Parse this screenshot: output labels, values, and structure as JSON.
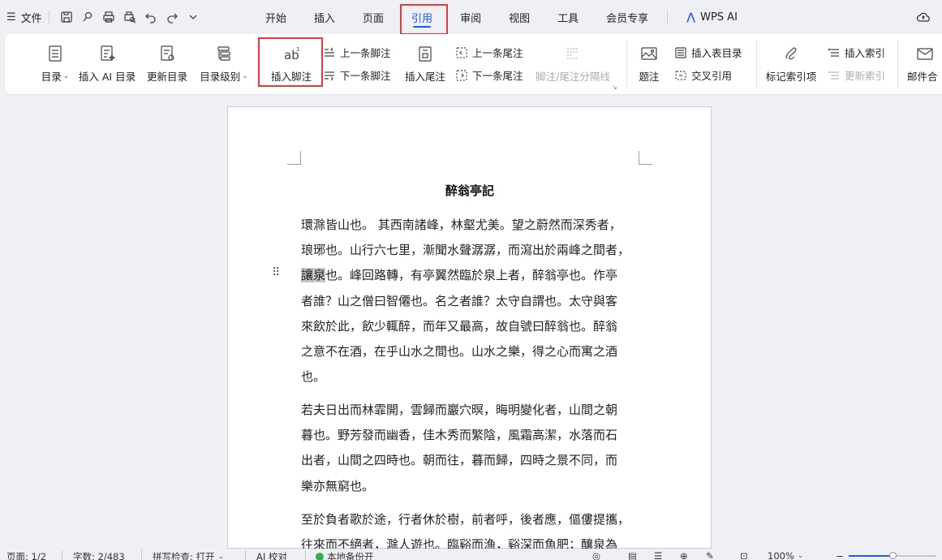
{
  "topbar": {
    "menu_icon": "hamburger-icon",
    "file_label": "文件",
    "quick_access": [
      "save-icon",
      "brush-icon",
      "print-icon",
      "print-preview-icon",
      "undo-icon",
      "redo-icon",
      "more-down-icon"
    ],
    "tabs": [
      {
        "label": "开始",
        "active": false
      },
      {
        "label": "插入",
        "active": false
      },
      {
        "label": "页面",
        "active": false
      },
      {
        "label": "引用",
        "active": true
      },
      {
        "label": "审阅",
        "active": false
      },
      {
        "label": "视图",
        "active": false
      },
      {
        "label": "工具",
        "active": false
      },
      {
        "label": "会员专享",
        "active": false
      }
    ],
    "wps_ai_label": "WPS AI",
    "accent_color": "#1a5cf0",
    "highlight_color": "#e8383d"
  },
  "ribbon": {
    "toc": "目录",
    "insert_ai_toc": "插入 AI 目录",
    "update_toc": "更新目录",
    "toc_level": "目录级别",
    "insert_footnote": "插入脚注",
    "prev_footnote": "上一条脚注",
    "next_footnote": "下一条脚注",
    "insert_endnote": "插入尾注",
    "prev_endnote": "上一条尾注",
    "next_endnote": "下一条尾注",
    "separator_line": "脚注/尾注分隔线",
    "caption": "题注",
    "insert_table_of_figures": "插入表目录",
    "cross_reference": "交叉引用",
    "mark_index_entry": "标记索引项",
    "insert_index": "插入索引",
    "update_index": "更新索引",
    "mail_merge": "邮件合"
  },
  "document": {
    "title": "醉翁亭記",
    "para1_lines": [
      "環滁皆山也。 其西南諸峰，林壑尤美。望之蔚然而深秀者，",
      "琅琊也。山行六七里，漸聞水聲潺潺，而瀉出於兩峰之間者，",
      "也。峰回路轉，有亭翼然臨於泉上者，醉翁亭也。作亭",
      "者誰？山之僧曰智僊也。名之者誰？太守自謂也。太守與客",
      "來飲於此，飲少輒醉，而年又最高，故自號曰醉翁也。醉翁",
      "之意不在酒，在乎山水之間也。山水之樂，得之心而寓之酒",
      "也。"
    ],
    "para1_highlight": "讓泉",
    "para2_lines": [
      "若夫日出而林霏開，雲歸而巖穴暝，晦明變化者，山間之朝",
      "暮也。野芳發而幽香，佳木秀而繁陰，風霜高潔，水落而石",
      "出者，山間之四時也。朝而往，暮而歸，四時之景不同，而",
      "樂亦無窮也。"
    ],
    "para3_lines": [
      "至於負者歌於途，行者休於樹，前者呼，後者應，傴僂提攜，",
      "往來而不絕者，滁人遊也。臨谿而漁，谿深而魚肥；釀泉為"
    ]
  },
  "statusbar": {
    "page": "页面: 1/2",
    "word_count": "字数: 2/483",
    "spell_check": "拼写检查: 打开",
    "ai_proofread": "AI 校对",
    "backup": "本地备份开",
    "zoom": "100%",
    "zoom_level_fraction": 0.5
  }
}
